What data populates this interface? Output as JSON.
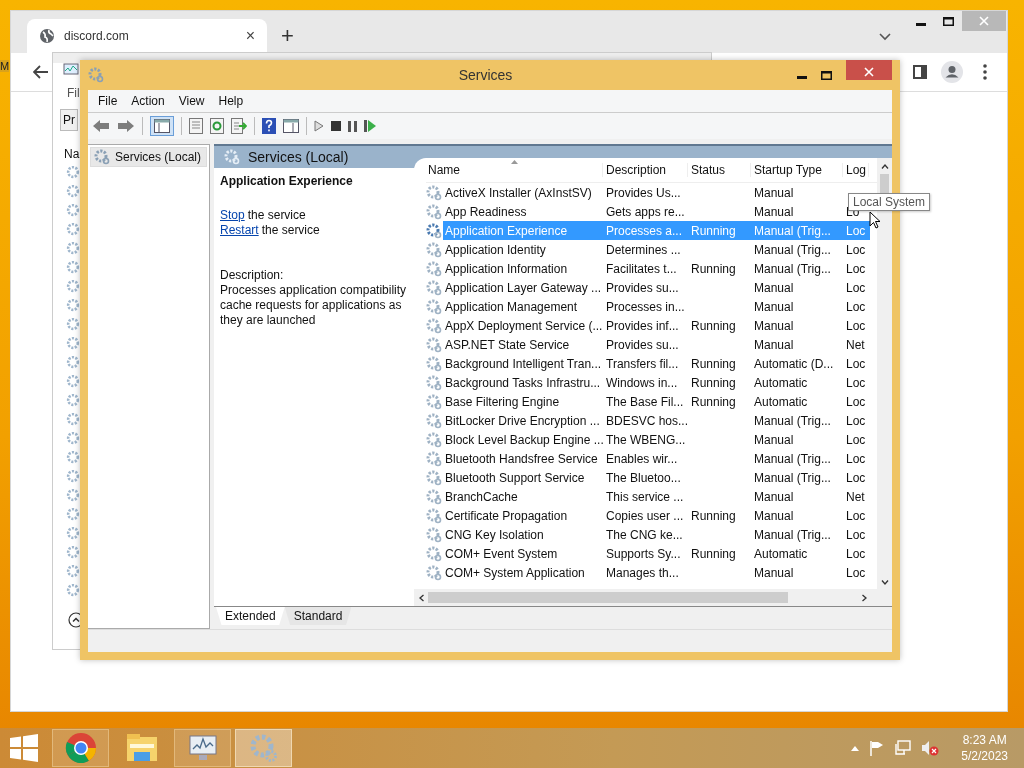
{
  "desktop_label": "M",
  "browser": {
    "tab": {
      "title": "discord.com",
      "close": "×"
    },
    "new_tab": "+"
  },
  "back_window": {
    "menu": "Fil",
    "tab": "Pr",
    "column": "Na"
  },
  "services": {
    "title": "Services",
    "menu": [
      "File",
      "Action",
      "View",
      "Help"
    ],
    "tree": [
      {
        "label": "Services (Local)",
        "selected": true
      }
    ],
    "header": "Services (Local)",
    "detail": {
      "title": "Application Experience",
      "actions": [
        {
          "link": "Stop",
          "text": "the service"
        },
        {
          "link": "Restart",
          "text": "the service"
        }
      ],
      "description_label": "Description:",
      "description": "Processes application compatibility cache requests for applications as they are launched"
    },
    "columns": [
      "Name",
      "Description",
      "Status",
      "Startup Type",
      "Log"
    ],
    "rows": [
      {
        "name": "ActiveX Installer (AxInstSV)",
        "description": "Provides Us...",
        "startup": "Manual",
        "selected": false
      },
      {
        "name": "App Readiness",
        "description": "Gets apps re...",
        "startup": "Manual",
        "log": "Lo",
        "selected": false
      },
      {
        "name": "Application Experience",
        "description": "Processes a...",
        "status": "Running",
        "startup": "Manual (Trig...",
        "log": "Loc",
        "selected": true
      },
      {
        "name": "Application Identity",
        "description": "Determines ...",
        "startup": "Manual (Trig...",
        "log": "Loc",
        "selected": false
      },
      {
        "name": "Application Information",
        "description": "Facilitates t...",
        "status": "Running",
        "startup": "Manual (Trig...",
        "log": "Loc",
        "selected": false
      },
      {
        "name": "Application Layer Gateway ...",
        "description": "Provides su...",
        "startup": "Manual",
        "log": "Loc",
        "selected": false
      },
      {
        "name": "Application Management",
        "description": "Processes in...",
        "startup": "Manual",
        "log": "Loc",
        "selected": false
      },
      {
        "name": "AppX Deployment Service (...",
        "description": "Provides inf...",
        "status": "Running",
        "startup": "Manual",
        "log": "Loc",
        "selected": false
      },
      {
        "name": "ASP.NET State Service",
        "description": "Provides su...",
        "startup": "Manual",
        "log": "Net",
        "selected": false
      },
      {
        "name": "Background Intelligent Tran...",
        "description": "Transfers fil...",
        "status": "Running",
        "startup": "Automatic (D...",
        "log": "Loc",
        "selected": false
      },
      {
        "name": "Background Tasks Infrastru...",
        "description": "Windows in...",
        "status": "Running",
        "startup": "Automatic",
        "log": "Loc",
        "selected": false
      },
      {
        "name": "Base Filtering Engine",
        "description": "The Base Fil...",
        "status": "Running",
        "startup": "Automatic",
        "log": "Loc",
        "selected": false
      },
      {
        "name": "BitLocker Drive Encryption ...",
        "description": "BDESVC hos...",
        "startup": "Manual (Trig...",
        "log": "Loc",
        "selected": false
      },
      {
        "name": "Block Level Backup Engine ...",
        "description": "The WBENG...",
        "startup": "Manual",
        "log": "Loc",
        "selected": false
      },
      {
        "name": "Bluetooth Handsfree Service",
        "description": "Enables wir...",
        "startup": "Manual (Trig...",
        "log": "Loc",
        "selected": false
      },
      {
        "name": "Bluetooth Support Service",
        "description": "The Bluetoo...",
        "startup": "Manual (Trig...",
        "log": "Loc",
        "selected": false
      },
      {
        "name": "BranchCache",
        "description": "This service ...",
        "startup": "Manual",
        "log": "Net",
        "selected": false
      },
      {
        "name": "Certificate Propagation",
        "description": "Copies user ...",
        "status": "Running",
        "startup": "Manual",
        "log": "Loc",
        "selected": false
      },
      {
        "name": "CNG Key Isolation",
        "description": "The CNG ke...",
        "startup": "Manual (Trig...",
        "log": "Loc",
        "selected": false
      },
      {
        "name": "COM+ Event System",
        "description": "Supports Sy...",
        "status": "Running",
        "startup": "Automatic",
        "log": "Loc",
        "selected": false
      },
      {
        "name": "COM+ System Application",
        "description": "Manages th...",
        "startup": "Manual",
        "log": "Loc",
        "selected": false
      }
    ],
    "tooltip": "Local System",
    "view_tabs": [
      {
        "label": "Extended",
        "selected": true
      },
      {
        "label": "Standard",
        "selected": false
      }
    ]
  },
  "taskbar": {
    "apps": [
      {
        "kind": "chrome",
        "running": true,
        "selected": false
      },
      {
        "kind": "explorer",
        "running": false,
        "selected": false
      },
      {
        "kind": "monitor",
        "running": true,
        "selected": false
      },
      {
        "kind": "services",
        "running": true,
        "selected": true
      }
    ],
    "time": "8:23 AM",
    "date": "5/2/2023"
  }
}
